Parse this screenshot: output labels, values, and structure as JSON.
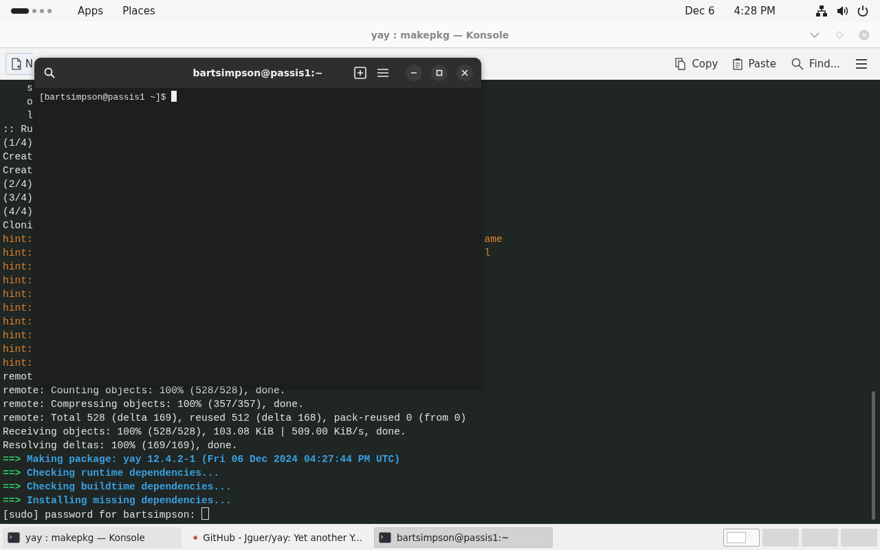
{
  "top_bar": {
    "workspaces": [
      {
        "selected": true
      },
      {
        "selected": false
      },
      {
        "selected": false
      },
      {
        "selected": false
      }
    ],
    "menus": [
      "Apps",
      "Places"
    ],
    "date": "Dec 6",
    "time": "4:28 PM"
  },
  "konsole": {
    "title": "yay : makepkg — Konsole",
    "toolbar": [
      {
        "kind": "newtab",
        "label": "N"
      },
      {
        "kind": "copy",
        "label": "Copy"
      },
      {
        "kind": "paste",
        "label": "Paste"
      },
      {
        "kind": "find",
        "label": "Find..."
      },
      {
        "kind": "menu"
      }
    ],
    "lines": [
      {
        "kind": "indented",
        "text": "s"
      },
      {
        "kind": "indented",
        "text": "o"
      },
      {
        "kind": "indented",
        "text": "l"
      },
      {
        "kind": "plain",
        "text": ":: Ru"
      },
      {
        "kind": "plain",
        "text": "(1/4)"
      },
      {
        "kind": "plain",
        "text": "Creat"
      },
      {
        "kind": "plain",
        "text": "Creat"
      },
      {
        "kind": "plain",
        "text": "(2/4)"
      },
      {
        "kind": "plain",
        "text": "(3/4)"
      },
      {
        "kind": "plain",
        "text": "(4/4)"
      },
      {
        "kind": "plain",
        "text": "Cloni"
      },
      {
        "kind": "hint",
        "text": "hint:",
        "tail": "ame"
      },
      {
        "kind": "hint",
        "text": "hint:",
        "tail": "l"
      },
      {
        "kind": "hint",
        "text": "hint:"
      },
      {
        "kind": "hint",
        "text": "hint:"
      },
      {
        "kind": "hint",
        "text": "hint:"
      },
      {
        "kind": "hint",
        "text": "hint:"
      },
      {
        "kind": "hint",
        "text": "hint:"
      },
      {
        "kind": "hint",
        "text": "hint:"
      },
      {
        "kind": "hint",
        "text": "hint:"
      },
      {
        "kind": "hint",
        "text": "hint:"
      },
      {
        "kind": "plain",
        "text": "remot"
      },
      {
        "kind": "plain",
        "text": "remote: Counting objects: 100% (528/528), done."
      },
      {
        "kind": "plain",
        "text": "remote: Compressing objects: 100% (357/357), done."
      },
      {
        "kind": "plain",
        "text": "remote: Total 528 (delta 169), reused 512 (delta 168), pack-reused 0 (from 0)"
      },
      {
        "kind": "plain",
        "text": "Receiving objects: 100% (528/528), 103.08 KiB | 509.00 KiB/s, done."
      },
      {
        "kind": "plain",
        "text": "Resolving deltas: 100% (169/169), done."
      },
      {
        "kind": "step",
        "arrow": "==>",
        "text": "Making package: yay 12.4.2-1 (Fri 06 Dec 2024 04:27:44 PM UTC)"
      },
      {
        "kind": "step",
        "arrow": "==>",
        "text": "Checking runtime dependencies..."
      },
      {
        "kind": "step",
        "arrow": "==>",
        "text": "Checking buildtime dependencies..."
      },
      {
        "kind": "step",
        "arrow": "==>",
        "text": "Installing missing dependencies..."
      },
      {
        "kind": "prompt",
        "text": "[sudo] password for bartsimpson:"
      }
    ]
  },
  "console": {
    "title": "bartsimpson@passis1:~",
    "prompt": "[bartsimpson@passis1 ~]$"
  },
  "taskbar": {
    "items": [
      {
        "kind": "terminal",
        "label": "yay : makepkg — Konsole",
        "selected": false
      },
      {
        "kind": "browser",
        "label": "GitHub - Jguer/yay: Yet another Y...",
        "selected": false
      },
      {
        "kind": "terminal",
        "label": "bartsimpson@passis1:~",
        "selected": true
      }
    ],
    "workspaces": [
      {
        "selected": true
      },
      {
        "selected": false
      },
      {
        "selected": false
      },
      {
        "selected": false
      }
    ]
  }
}
